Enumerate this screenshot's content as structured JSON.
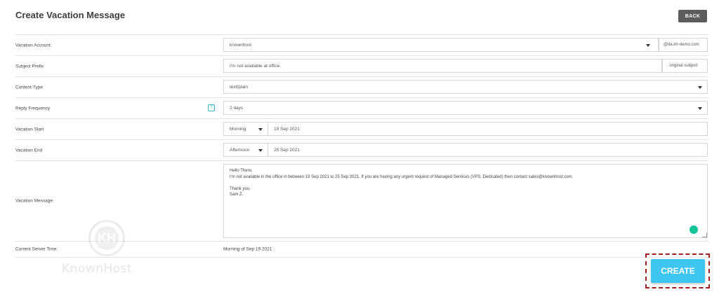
{
  "page": {
    "title": "Create Vacation Message",
    "back_label": "BACK",
    "create_label": "CREATE"
  },
  "form": {
    "vacation_account": {
      "label": "Vacation Account:",
      "value": "knownhost",
      "domain": "@da.kh-demo.com"
    },
    "subject_prefix": {
      "label": "Subject Prefix",
      "value": "I'm not available at office.",
      "suffix": ": original subject"
    },
    "content_type": {
      "label": "Content-Type",
      "value": "text/plain"
    },
    "reply_frequency": {
      "label": "Reply Frequency",
      "help": "?",
      "value": "2 days"
    },
    "vacation_start": {
      "label": "Vacation Start",
      "time_of_day": "Morning",
      "date": "19 Sep 2021"
    },
    "vacation_end": {
      "label": "Vacation End",
      "time_of_day": "Afternoon",
      "date": "25 Sep 2021"
    },
    "vacation_message": {
      "label": "Vacation Message:",
      "lines": [
        "Hello There,",
        "I'm not available in the office in between 19 Sep 2021 to 25 Sep 2021, If you are having any urgent request of Managed Services (VPS, Dedicated) then contact sales@knownhost.com.",
        "",
        "Thank you,",
        "Sam Z."
      ]
    },
    "current_server_time": {
      "label": "Current Server Time:",
      "value": "Morning of Sep 19 2021"
    }
  },
  "watermark": {
    "logo_letters": "KH",
    "text": "KnownHost"
  },
  "colors": {
    "create_button": "#3ec6f0",
    "back_button": "#5c5c5c",
    "highlight_border": "#a31e1e",
    "help_icon": "#39b3c6",
    "grammarly": "#15c39a"
  },
  "icons": [
    "dropdown-caret-icon",
    "help-icon",
    "grammarly-icon",
    "resize-handle-icon"
  ]
}
